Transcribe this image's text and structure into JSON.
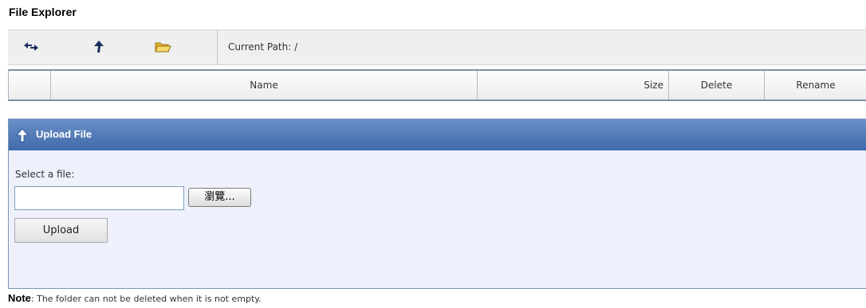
{
  "page_title": "File Explorer",
  "toolbar": {
    "icons": [
      "refresh-arrows-icon",
      "up-arrow-icon",
      "open-folder-icon"
    ],
    "current_path_label": "Current Path: /"
  },
  "grid": {
    "columns": [
      "",
      "Name",
      "Size",
      "Delete",
      "Rename"
    ]
  },
  "upload": {
    "header_label": "Upload File",
    "select_label": "Select a file:",
    "file_value": "",
    "browse_label": "瀏覽...",
    "upload_button": "Upload"
  },
  "note": {
    "prefix": "Note",
    "text": ": The folder can not be deleted when it is not empty."
  },
  "colors": {
    "header_blue": "#4f78b6",
    "upload_bg": "#eef1fb",
    "toolbar_bg": "#efefef"
  }
}
